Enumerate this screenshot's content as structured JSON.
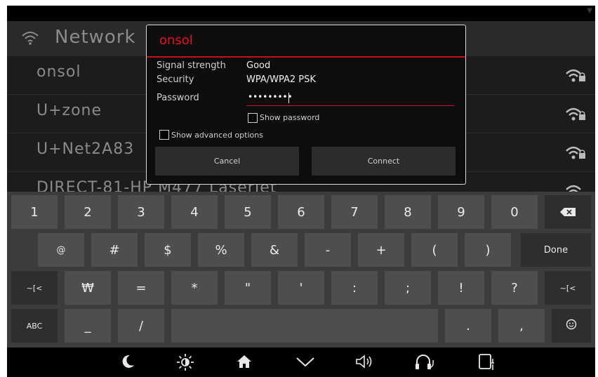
{
  "network_list": {
    "title": "Network",
    "networks": [
      {
        "name": "onsol"
      },
      {
        "name": "U+zone"
      },
      {
        "name": "U+Net2A83"
      },
      {
        "name": "DIRECT-81-HP M477 LaserJet"
      }
    ]
  },
  "dialog": {
    "title": "onsol",
    "signal_label": "Signal strength",
    "signal_value": "Good",
    "security_label": "Security",
    "security_value": "WPA/WPA2 PSK",
    "password_label": "Password",
    "password_value": "•••••••••",
    "show_password_label": "Show password",
    "show_advanced_label": "Show advanced options",
    "cancel_label": "Cancel",
    "connect_label": "Connect"
  },
  "keyboard": {
    "row1": [
      "1",
      "2",
      "3",
      "4",
      "5",
      "6",
      "7",
      "8",
      "9",
      "0"
    ],
    "row2": [
      "@",
      "#",
      "$",
      "%",
      "&",
      "-",
      "+",
      "(",
      ")"
    ],
    "done_label": "Done",
    "row3": [
      "~[<",
      "₩",
      "=",
      "*",
      "\"",
      "'",
      ":",
      ";",
      "!",
      "?",
      "~[<"
    ],
    "row4_left": "ABC",
    "row4": [
      "_",
      "/"
    ],
    "row4_right": [
      ".",
      ","
    ]
  },
  "colors": {
    "accent": "#e0141e",
    "dialog_bg": "#0d0d0d",
    "key_bg": "#4e4e4e",
    "keyboard_bg": "#3c3c3c"
  },
  "icons": {
    "header": "wifi-icon",
    "network_row": "wifi-lock-icon",
    "backspace": "backspace-icon",
    "emoji": "emoji-icon",
    "nav": [
      "moon-icon",
      "brightness-icon",
      "home-icon",
      "chevron-down-icon",
      "volume-icon",
      "headset-icon",
      "phone-connect-icon"
    ]
  }
}
